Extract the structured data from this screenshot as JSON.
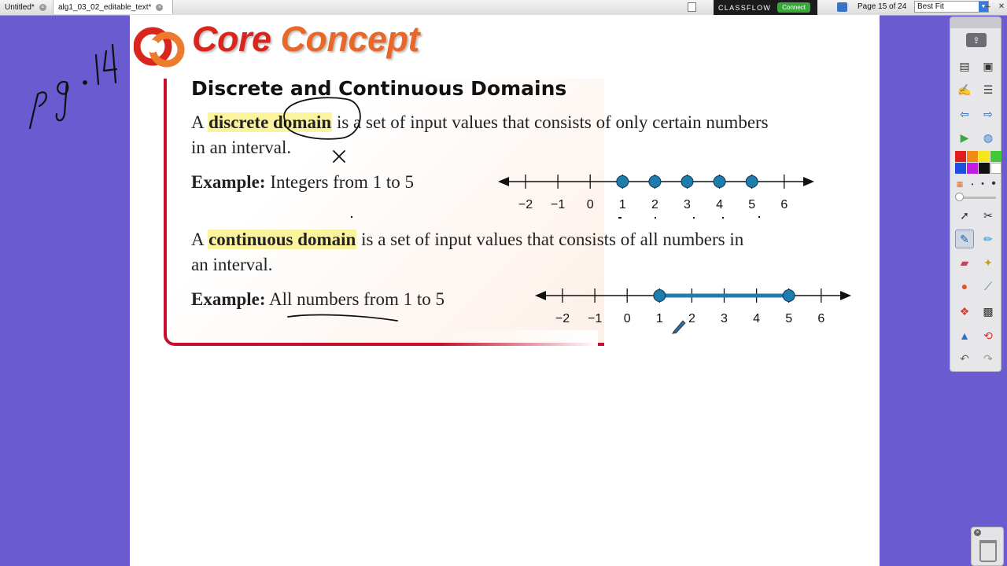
{
  "tabs": [
    {
      "label": "Untitled*",
      "active": false
    },
    {
      "label": "alg1_03_02_editable_text*",
      "active": true
    }
  ],
  "classflow": {
    "brand": "CLASSFLOW",
    "connect": "Connect"
  },
  "page_indicator": "Page 15 of 24",
  "zoom": {
    "selected": "Best Fit"
  },
  "window": {
    "minimize": "–",
    "close": "✕"
  },
  "content": {
    "banner": {
      "title_a": "Core",
      "title_b": "Concept"
    },
    "heading": "Discrete and Continuous Domains",
    "discrete": {
      "prefix": "A ",
      "term": "discrete domain",
      "line1_rest": " is a set of input values that consists of only certain numbers",
      "line2": "in an interval.",
      "example_label": "Example:",
      "example_text": "Integers from 1 to 5",
      "number_line": {
        "min": -2,
        "max": 6,
        "points": [
          1,
          2,
          3,
          4,
          5
        ]
      }
    },
    "continuous": {
      "prefix": "A ",
      "term": "continuous domain",
      "line1_rest": " is a set of input values that consists of all numbers in",
      "line2": "an interval.",
      "example_label": "Example:",
      "example_text": "All numbers from 1 to 5",
      "number_line": {
        "min": -2,
        "max": 6,
        "interval": [
          1,
          5
        ]
      }
    },
    "tick_labels": [
      "−2",
      "−1",
      "0",
      "1",
      "2",
      "3",
      "4",
      "5",
      "6"
    ]
  },
  "annotations": {
    "side_note": "pg .114",
    "mark": "X"
  },
  "colors": {
    "background": "#6a5bd0",
    "highlight": "#fbf39d",
    "box_border": "#c8102e",
    "point_fill": "#1f7dae"
  }
}
